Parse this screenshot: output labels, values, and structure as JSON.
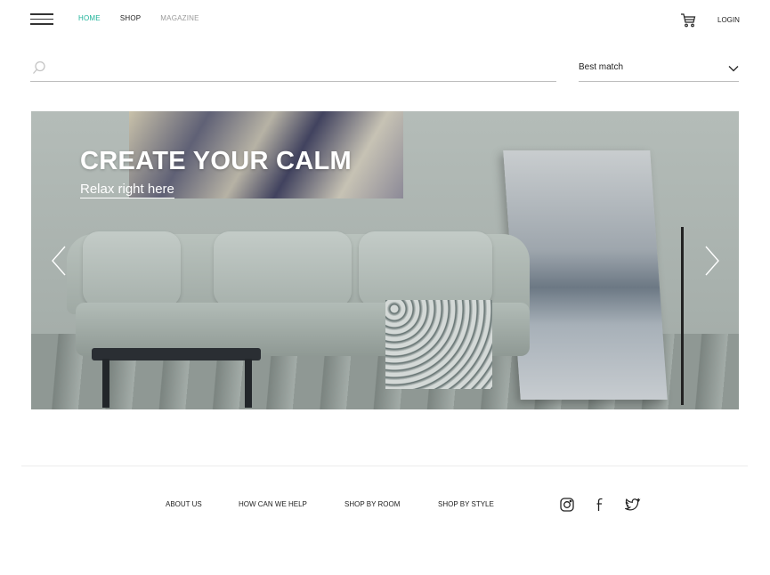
{
  "header": {
    "nav": {
      "home": "HOME",
      "shop": "SHOP",
      "magazine": "MAGAZINE"
    },
    "login_label": "LOGIN",
    "menu_icon": "hamburger-menu-icon",
    "cart_icon": "shopping-cart-icon",
    "active_color": "#1fb39a"
  },
  "search": {
    "value": "",
    "icon": "search-icon"
  },
  "sort": {
    "selected": "Best match",
    "icon": "chevron-down-icon"
  },
  "hero": {
    "headline": "CREATE YOUR CALM",
    "subline": "Relax right here",
    "prev_icon": "chevron-left-icon",
    "next_icon": "chevron-right-icon"
  },
  "footer": {
    "links": {
      "about": "ABOUT US",
      "help": "HOW CAN WE HELP",
      "room": "SHOP BY  ROOM",
      "style": "SHOP BY  STYLE"
    },
    "social": [
      "instagram-icon",
      "facebook-icon",
      "twitter-icon"
    ]
  }
}
